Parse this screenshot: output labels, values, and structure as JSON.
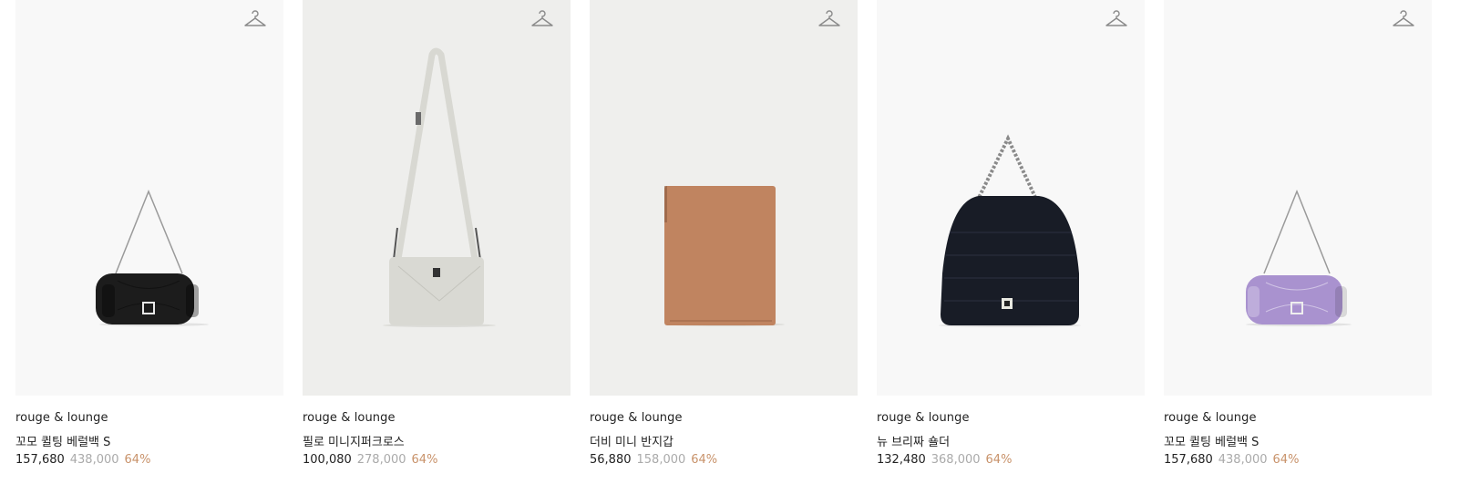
{
  "colors": {
    "discount": "#c8926a",
    "original_price": "#aaaaaa",
    "text": "#222222"
  },
  "products": [
    {
      "brand": "rouge & lounge",
      "name": "꼬모 퀼팅 베럴백 S",
      "price": "157,680",
      "original_price": "438,000",
      "discount": "64%",
      "bg": "#f8f8f8",
      "bag_color": "#1c1c1c",
      "icon": "hanger-icon"
    },
    {
      "brand": "rouge & lounge",
      "name": "필로 미니지퍼크로스",
      "price": "100,080",
      "original_price": "278,000",
      "discount": "64%",
      "bg": "#eeeeec",
      "bag_color": "#d9d9d3",
      "icon": "hanger-icon"
    },
    {
      "brand": "rouge & lounge",
      "name": "더비 미니 반지갑",
      "price": "56,880",
      "original_price": "158,000",
      "discount": "64%",
      "bg": "#efefed",
      "bag_color": "#c08460",
      "icon": "hanger-icon"
    },
    {
      "brand": "rouge & lounge",
      "name": "뉴 브리짜 숄더",
      "price": "132,480",
      "original_price": "368,000",
      "discount": "64%",
      "bg": "#f8f8f8",
      "bag_color": "#181c26",
      "icon": "hanger-icon"
    },
    {
      "brand": "rouge & lounge",
      "name": "꼬모 퀼팅 베럴백 S",
      "price": "157,680",
      "original_price": "438,000",
      "discount": "64%",
      "bg": "#f8f8f8",
      "bag_color": "#a992cf",
      "icon": "hanger-icon"
    }
  ]
}
